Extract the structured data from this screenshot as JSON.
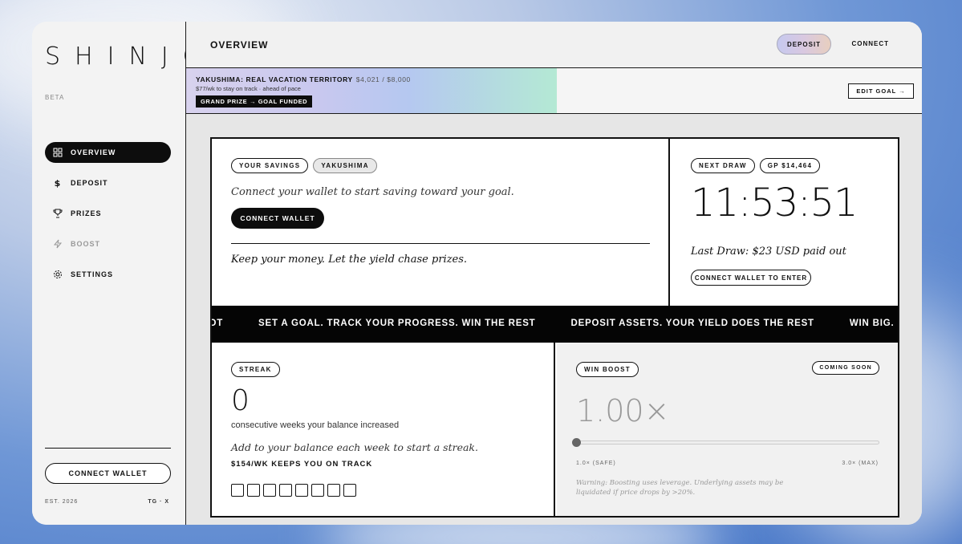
{
  "brand": {
    "logo": "SHINJO",
    "beta": "BETA",
    "est": "EST. 2026",
    "links": "TG · X"
  },
  "sidebar": {
    "items": [
      {
        "label": "OVERVIEW",
        "icon": "grid-icon",
        "active": true
      },
      {
        "label": "DEPOSIT",
        "icon": "dollar-icon"
      },
      {
        "label": "PRIZES",
        "icon": "trophy-icon"
      },
      {
        "label": "BOOST",
        "icon": "lightning-icon",
        "disabled": true
      },
      {
        "label": "SETTINGS",
        "icon": "gear-icon"
      }
    ],
    "connect_label": "CONNECT WALLET"
  },
  "header": {
    "title": "OVERVIEW",
    "deposit_label": "DEPOSIT",
    "connect_label": "CONNECT"
  },
  "goal": {
    "title": "YAKUSHIMA: REAL VACATION TERRITORY",
    "amount": "$4,021 / $8,000",
    "subtitle": "$77/wk to stay on track · ahead of pace",
    "badge": "GRAND PRIZE → GOAL FUNDED",
    "edit_label": "EDIT GOAL →",
    "progress_fraction": 0.5026
  },
  "savings": {
    "pill_1": "YOUR SAVINGS",
    "pill_2": "YAKUSHIMA",
    "message": "Connect your wallet to start saving toward your goal.",
    "connect_label": "CONNECT WALLET",
    "tagline": "Keep your money. Let the yield chase prizes."
  },
  "draw": {
    "pill_1": "NEXT DRAW",
    "pill_2": "GP $14,464",
    "timer": "11:53:51",
    "last_draw": "Last Draw: $23 USD paid out",
    "enter_label": "CONNECT WALLET TO ENTER"
  },
  "ticker": {
    "items": [
      "POT",
      "SET A GOAL. TRACK YOUR PROGRESS. WIN THE REST",
      "DEPOSIT ASSETS. YOUR YIELD DOES THE REST",
      "WIN BIG. LOSE NOTHING"
    ]
  },
  "streak": {
    "pill": "STREAK",
    "count": "0",
    "subtitle": "consecutive weeks your balance increased",
    "hint": "Add to your balance each week to start a streak.",
    "track": "$154/WK KEEPS YOU ON TRACK",
    "weeks": 8
  },
  "boost": {
    "pill": "WIN BOOST",
    "coming_soon": "COMING SOON",
    "value": "1.00×",
    "min_label": "1.0× (SAFE)",
    "max_label": "3.0× (MAX)",
    "warning": "Warning: Boosting uses leverage. Underlying assets may be liquidated if price drops by >20%.",
    "slider_fraction": 0
  }
}
